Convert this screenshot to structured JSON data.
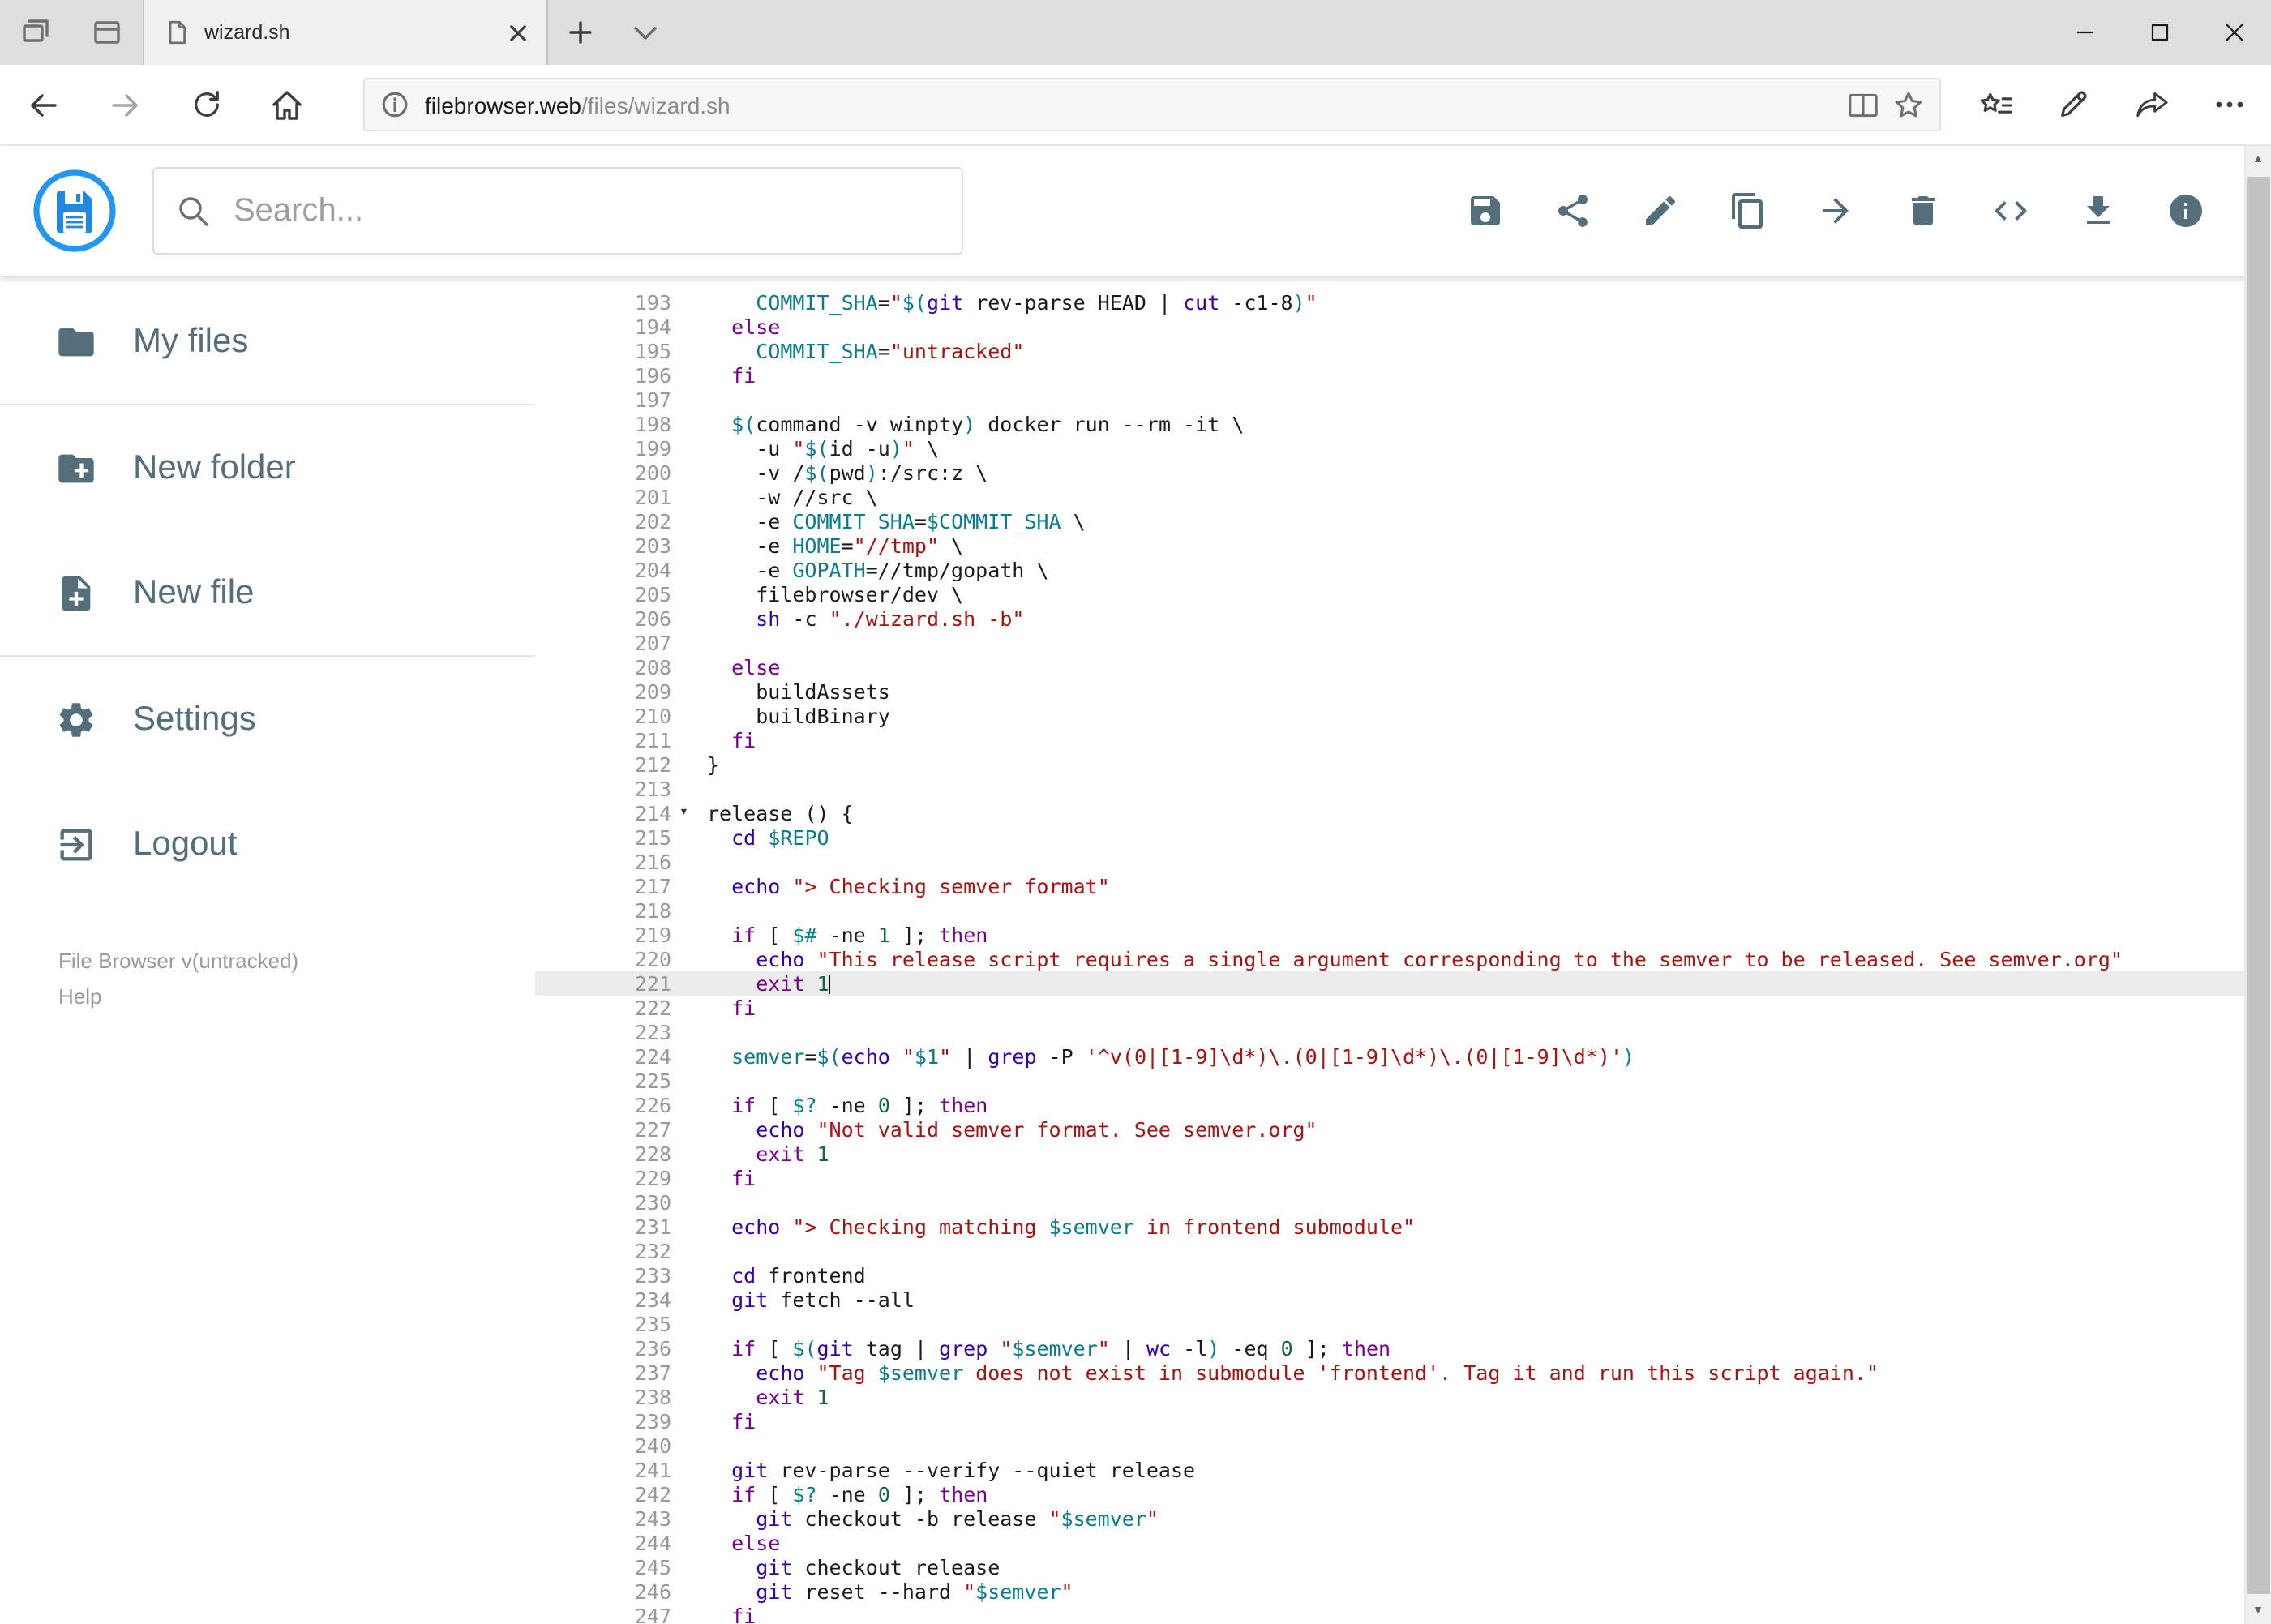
{
  "browser": {
    "tab": {
      "title": "wizard.sh"
    },
    "tab_strip_icons": [
      "set-tabs-aside",
      "tab-preview",
      "new-tab",
      "tab-list-chevron"
    ],
    "window_controls": [
      "minimize",
      "maximize",
      "close"
    ],
    "address": {
      "host": "filebrowser.web",
      "path": "/files/wizard.sh"
    },
    "nav_icons": [
      "back",
      "forward",
      "refresh",
      "home"
    ],
    "address_icons": [
      "page-info",
      "reading-view",
      "favorite-star"
    ],
    "hub_icons": [
      "favorites-hub",
      "web-note-pen",
      "share",
      "more-ellipsis"
    ]
  },
  "app": {
    "colors": {
      "accent": "#2196f3",
      "icon": "#546e7a"
    },
    "search": {
      "placeholder": "Search..."
    },
    "toolbar": {
      "icons": [
        "save",
        "share",
        "edit",
        "copy",
        "move",
        "delete",
        "code",
        "download",
        "info"
      ]
    },
    "sidebar": {
      "items": [
        {
          "label": "My files",
          "icon": "folder"
        },
        {
          "label": "New folder",
          "icon": "folder-plus"
        },
        {
          "label": "New file",
          "icon": "file-plus"
        },
        {
          "label": "Settings",
          "icon": "gear"
        },
        {
          "label": "Logout",
          "icon": "logout"
        }
      ],
      "footer": {
        "version": "File Browser v(untracked)",
        "help": "Help"
      }
    }
  },
  "editor": {
    "language": "shell",
    "active_line": 221,
    "lines": [
      {
        "n": 193,
        "t": [
          [
            "p",
            "    "
          ],
          [
            "v",
            "COMMIT_SHA"
          ],
          [
            "p",
            "="
          ],
          [
            "s",
            "\""
          ],
          [
            "v",
            "$("
          ],
          [
            "c",
            "git"
          ],
          [
            "p",
            " rev-parse HEAD | "
          ],
          [
            "c",
            "cut"
          ],
          [
            "p",
            " -c1-8"
          ],
          [
            "v",
            ")"
          ],
          [
            "s",
            "\""
          ]
        ]
      },
      {
        "n": 194,
        "t": [
          [
            "p",
            "  "
          ],
          [
            "k",
            "else"
          ]
        ]
      },
      {
        "n": 195,
        "t": [
          [
            "p",
            "    "
          ],
          [
            "v",
            "COMMIT_SHA"
          ],
          [
            "p",
            "="
          ],
          [
            "s",
            "\"untracked\""
          ]
        ]
      },
      {
        "n": 196,
        "t": [
          [
            "p",
            "  "
          ],
          [
            "k",
            "fi"
          ]
        ]
      },
      {
        "n": 197,
        "t": []
      },
      {
        "n": 198,
        "t": [
          [
            "p",
            "  "
          ],
          [
            "v",
            "$("
          ],
          [
            "p",
            "command -v winpty"
          ],
          [
            "v",
            ")"
          ],
          [
            "p",
            " docker run --rm -it \\"
          ]
        ]
      },
      {
        "n": 199,
        "t": [
          [
            "p",
            "    -u "
          ],
          [
            "s",
            "\""
          ],
          [
            "v",
            "$("
          ],
          [
            "p",
            "id -u"
          ],
          [
            "v",
            ")"
          ],
          [
            "s",
            "\""
          ],
          [
            "p",
            " \\"
          ]
        ]
      },
      {
        "n": 200,
        "t": [
          [
            "p",
            "    -v /"
          ],
          [
            "v",
            "$("
          ],
          [
            "p",
            "pwd"
          ],
          [
            "v",
            ")"
          ],
          [
            "p",
            ":/src:z \\"
          ]
        ]
      },
      {
        "n": 201,
        "t": [
          [
            "p",
            "    -w //src \\"
          ]
        ]
      },
      {
        "n": 202,
        "t": [
          [
            "p",
            "    -e "
          ],
          [
            "v",
            "COMMIT_SHA"
          ],
          [
            "p",
            "="
          ],
          [
            "v",
            "$COMMIT_SHA"
          ],
          [
            "p",
            " \\"
          ]
        ]
      },
      {
        "n": 203,
        "t": [
          [
            "p",
            "    -e "
          ],
          [
            "v",
            "HOME"
          ],
          [
            "p",
            "="
          ],
          [
            "s",
            "\"//tmp\""
          ],
          [
            "p",
            " \\"
          ]
        ]
      },
      {
        "n": 204,
        "t": [
          [
            "p",
            "    -e "
          ],
          [
            "v",
            "GOPATH"
          ],
          [
            "p",
            "=//tmp/gopath \\"
          ]
        ]
      },
      {
        "n": 205,
        "t": [
          [
            "p",
            "    filebrowser/dev \\"
          ]
        ]
      },
      {
        "n": 206,
        "t": [
          [
            "p",
            "    "
          ],
          [
            "c",
            "sh"
          ],
          [
            "p",
            " -c "
          ],
          [
            "s",
            "\"./wizard.sh -b\""
          ]
        ]
      },
      {
        "n": 207,
        "t": []
      },
      {
        "n": 208,
        "t": [
          [
            "p",
            "  "
          ],
          [
            "k",
            "else"
          ]
        ]
      },
      {
        "n": 209,
        "t": [
          [
            "p",
            "    buildAssets"
          ]
        ]
      },
      {
        "n": 210,
        "t": [
          [
            "p",
            "    buildBinary"
          ]
        ]
      },
      {
        "n": 211,
        "t": [
          [
            "p",
            "  "
          ],
          [
            "k",
            "fi"
          ]
        ]
      },
      {
        "n": 212,
        "t": [
          [
            "p",
            "}"
          ]
        ]
      },
      {
        "n": 213,
        "t": []
      },
      {
        "n": 214,
        "fold": true,
        "t": [
          [
            "p",
            "release () {"
          ]
        ]
      },
      {
        "n": 215,
        "t": [
          [
            "p",
            "  "
          ],
          [
            "c",
            "cd"
          ],
          [
            "p",
            " "
          ],
          [
            "v",
            "$REPO"
          ]
        ]
      },
      {
        "n": 216,
        "t": []
      },
      {
        "n": 217,
        "t": [
          [
            "p",
            "  "
          ],
          [
            "c",
            "echo"
          ],
          [
            "p",
            " "
          ],
          [
            "s",
            "\"> Checking semver format\""
          ]
        ]
      },
      {
        "n": 218,
        "t": []
      },
      {
        "n": 219,
        "t": [
          [
            "p",
            "  "
          ],
          [
            "k",
            "if"
          ],
          [
            "p",
            " [ "
          ],
          [
            "v",
            "$#"
          ],
          [
            "p",
            " -ne "
          ],
          [
            "num",
            "1"
          ],
          [
            "p",
            " ]; "
          ],
          [
            "k",
            "then"
          ]
        ]
      },
      {
        "n": 220,
        "t": [
          [
            "p",
            "    "
          ],
          [
            "c",
            "echo"
          ],
          [
            "p",
            " "
          ],
          [
            "s",
            "\"This release script requires a single argument corresponding to the semver to be released. See semver.org\""
          ]
        ]
      },
      {
        "n": 221,
        "active": true,
        "cursor": true,
        "t": [
          [
            "p",
            "    "
          ],
          [
            "k",
            "exit"
          ],
          [
            "p",
            " "
          ],
          [
            "num",
            "1"
          ]
        ]
      },
      {
        "n": 222,
        "t": [
          [
            "p",
            "  "
          ],
          [
            "k",
            "fi"
          ]
        ]
      },
      {
        "n": 223,
        "t": []
      },
      {
        "n": 224,
        "t": [
          [
            "p",
            "  "
          ],
          [
            "v",
            "semver"
          ],
          [
            "p",
            "="
          ],
          [
            "v",
            "$("
          ],
          [
            "c",
            "echo"
          ],
          [
            "p",
            " "
          ],
          [
            "s",
            "\""
          ],
          [
            "v",
            "$1"
          ],
          [
            "s",
            "\""
          ],
          [
            "p",
            " | "
          ],
          [
            "c",
            "grep"
          ],
          [
            "p",
            " -P "
          ],
          [
            "s",
            "'^v(0|[1-9]\\d*)\\.(0|[1-9]\\d*)\\.(0|[1-9]\\d*)'"
          ],
          [
            "v",
            ")"
          ]
        ]
      },
      {
        "n": 225,
        "t": []
      },
      {
        "n": 226,
        "t": [
          [
            "p",
            "  "
          ],
          [
            "k",
            "if"
          ],
          [
            "p",
            " [ "
          ],
          [
            "v",
            "$?"
          ],
          [
            "p",
            " -ne "
          ],
          [
            "num",
            "0"
          ],
          [
            "p",
            " ]; "
          ],
          [
            "k",
            "then"
          ]
        ]
      },
      {
        "n": 227,
        "t": [
          [
            "p",
            "    "
          ],
          [
            "c",
            "echo"
          ],
          [
            "p",
            " "
          ],
          [
            "s",
            "\"Not valid semver format. See semver.org\""
          ]
        ]
      },
      {
        "n": 228,
        "t": [
          [
            "p",
            "    "
          ],
          [
            "k",
            "exit"
          ],
          [
            "p",
            " "
          ],
          [
            "num",
            "1"
          ]
        ]
      },
      {
        "n": 229,
        "t": [
          [
            "p",
            "  "
          ],
          [
            "k",
            "fi"
          ]
        ]
      },
      {
        "n": 230,
        "t": []
      },
      {
        "n": 231,
        "t": [
          [
            "p",
            "  "
          ],
          [
            "c",
            "echo"
          ],
          [
            "p",
            " "
          ],
          [
            "s",
            "\"> Checking matching "
          ],
          [
            "v",
            "$semver"
          ],
          [
            "s",
            " in frontend submodule\""
          ]
        ]
      },
      {
        "n": 232,
        "t": []
      },
      {
        "n": 233,
        "t": [
          [
            "p",
            "  "
          ],
          [
            "c",
            "cd"
          ],
          [
            "p",
            " frontend"
          ]
        ]
      },
      {
        "n": 234,
        "t": [
          [
            "p",
            "  "
          ],
          [
            "c",
            "git"
          ],
          [
            "p",
            " fetch --all"
          ]
        ]
      },
      {
        "n": 235,
        "t": []
      },
      {
        "n": 236,
        "t": [
          [
            "p",
            "  "
          ],
          [
            "k",
            "if"
          ],
          [
            "p",
            " [ "
          ],
          [
            "v",
            "$("
          ],
          [
            "c",
            "git"
          ],
          [
            "p",
            " tag | "
          ],
          [
            "c",
            "grep"
          ],
          [
            "p",
            " "
          ],
          [
            "s",
            "\""
          ],
          [
            "v",
            "$semver"
          ],
          [
            "s",
            "\""
          ],
          [
            "p",
            " | "
          ],
          [
            "c",
            "wc"
          ],
          [
            "p",
            " -l"
          ],
          [
            "v",
            ")"
          ],
          [
            "p",
            " -eq "
          ],
          [
            "num",
            "0"
          ],
          [
            "p",
            " ]; "
          ],
          [
            "k",
            "then"
          ]
        ]
      },
      {
        "n": 237,
        "t": [
          [
            "p",
            "    "
          ],
          [
            "c",
            "echo"
          ],
          [
            "p",
            " "
          ],
          [
            "s",
            "\"Tag "
          ],
          [
            "v",
            "$semver"
          ],
          [
            "s",
            " does not exist in submodule 'frontend'. Tag it and run this script again.\""
          ]
        ]
      },
      {
        "n": 238,
        "t": [
          [
            "p",
            "    "
          ],
          [
            "k",
            "exit"
          ],
          [
            "p",
            " "
          ],
          [
            "num",
            "1"
          ]
        ]
      },
      {
        "n": 239,
        "t": [
          [
            "p",
            "  "
          ],
          [
            "k",
            "fi"
          ]
        ]
      },
      {
        "n": 240,
        "t": []
      },
      {
        "n": 241,
        "t": [
          [
            "p",
            "  "
          ],
          [
            "c",
            "git"
          ],
          [
            "p",
            " rev-parse --verify --quiet release"
          ]
        ]
      },
      {
        "n": 242,
        "t": [
          [
            "p",
            "  "
          ],
          [
            "k",
            "if"
          ],
          [
            "p",
            " [ "
          ],
          [
            "v",
            "$?"
          ],
          [
            "p",
            " -ne "
          ],
          [
            "num",
            "0"
          ],
          [
            "p",
            " ]; "
          ],
          [
            "k",
            "then"
          ]
        ]
      },
      {
        "n": 243,
        "t": [
          [
            "p",
            "    "
          ],
          [
            "c",
            "git"
          ],
          [
            "p",
            " checkout -b release "
          ],
          [
            "s",
            "\""
          ],
          [
            "v",
            "$semver"
          ],
          [
            "s",
            "\""
          ]
        ]
      },
      {
        "n": 244,
        "t": [
          [
            "p",
            "  "
          ],
          [
            "k",
            "else"
          ]
        ]
      },
      {
        "n": 245,
        "t": [
          [
            "p",
            "    "
          ],
          [
            "c",
            "git"
          ],
          [
            "p",
            " checkout release"
          ]
        ]
      },
      {
        "n": 246,
        "t": [
          [
            "p",
            "    "
          ],
          [
            "c",
            "git"
          ],
          [
            "p",
            " reset --hard "
          ],
          [
            "s",
            "\""
          ],
          [
            "v",
            "$semver"
          ],
          [
            "s",
            "\""
          ]
        ]
      },
      {
        "n": 247,
        "t": [
          [
            "p",
            "  "
          ],
          [
            "k",
            "fi"
          ]
        ]
      }
    ]
  }
}
